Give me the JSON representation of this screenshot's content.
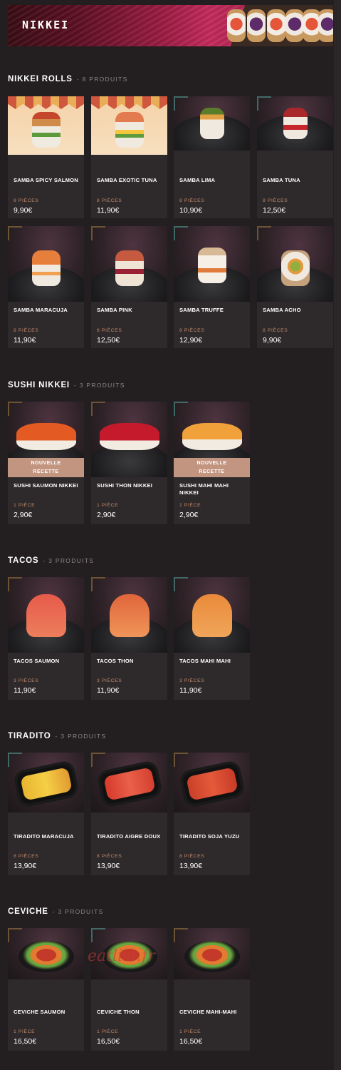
{
  "banner": {
    "title": "NIKKEI"
  },
  "sections": [
    {
      "title": "NIKKEI ROLLS",
      "count": "8 PRODUITS",
      "items": [
        {
          "name": "SAMBA SPICY SALMON",
          "qty": "8 PIÈCES",
          "price": "9,90€"
        },
        {
          "name": "SAMBA EXOTIC TUNA",
          "qty": "8 PIÈCES",
          "price": "11,90€"
        },
        {
          "name": "SAMBA LIMA",
          "qty": "8 PIÈCES",
          "price": "10,90€"
        },
        {
          "name": "SAMBA TUNA",
          "qty": "8 PIÈCES",
          "price": "12,50€"
        },
        {
          "name": "SAMBA MARACUJA",
          "qty": "8 PIÈCES",
          "price": "11,90€"
        },
        {
          "name": "SAMBA PINK",
          "qty": "8 PIÈCES",
          "price": "12,50€"
        },
        {
          "name": "SAMBA TRUFFE",
          "qty": "8 PIÈCES",
          "price": "12,90€"
        },
        {
          "name": "SAMBA ACHO",
          "qty": "8 PIÈCES",
          "price": "9,90€"
        }
      ]
    },
    {
      "title": "SUSHI NIKKEI",
      "count": "3 PRODUITS",
      "items": [
        {
          "name": "SUSHI SAUMON NIKKEI",
          "qty": "1 PIÈCE",
          "price": "2,90€",
          "badge_line1": "NOUVELLE",
          "badge_line2": "RECETTE"
        },
        {
          "name": "SUSHI THON NIKKEI",
          "qty": "1 PIÈCE",
          "price": "2,90€"
        },
        {
          "name": "SUSHI MAHI MAHI NIKKEI",
          "qty": "1 PIÈCE",
          "price": "2,90€",
          "badge_line1": "NOUVELLE",
          "badge_line2": "RECETTE"
        }
      ]
    },
    {
      "title": "TACOS",
      "count": "3 PRODUITS",
      "items": [
        {
          "name": "TACOS SAUMON",
          "qty": "3 PIÈCES",
          "price": "11,90€"
        },
        {
          "name": "TACOS THON",
          "qty": "3 PIÈCES",
          "price": "11,90€"
        },
        {
          "name": "TACOS MAHI MAHI",
          "qty": "3 PIÈCES",
          "price": "11,90€"
        }
      ]
    },
    {
      "title": "TIRADITO",
      "count": "3 PRODUITS",
      "items": [
        {
          "name": "TIRADITO MARACUJA",
          "qty": "8 PIÈCES",
          "price": "13,90€"
        },
        {
          "name": "TIRADITO AIGRE DOUX",
          "qty": "8 PIÈCES",
          "price": "13,90€"
        },
        {
          "name": "TIRADITO SOJA YUZU",
          "qty": "8 PIÈCES",
          "price": "13,90€"
        }
      ]
    },
    {
      "title": "CEVICHE",
      "count": "3 PRODUITS",
      "items": [
        {
          "name": "CEVICHE SAUMON",
          "qty": "1 PIÈCE",
          "price": "16,50€"
        },
        {
          "name": "CEVICHE THON",
          "qty": "1 PIÈCE",
          "price": "16,50€"
        },
        {
          "name": "CEVICHE MAHI-MAHI",
          "qty": "1 PIÈCE",
          "price": "16,50€"
        }
      ]
    }
  ],
  "watermark": "eatlist.fr"
}
